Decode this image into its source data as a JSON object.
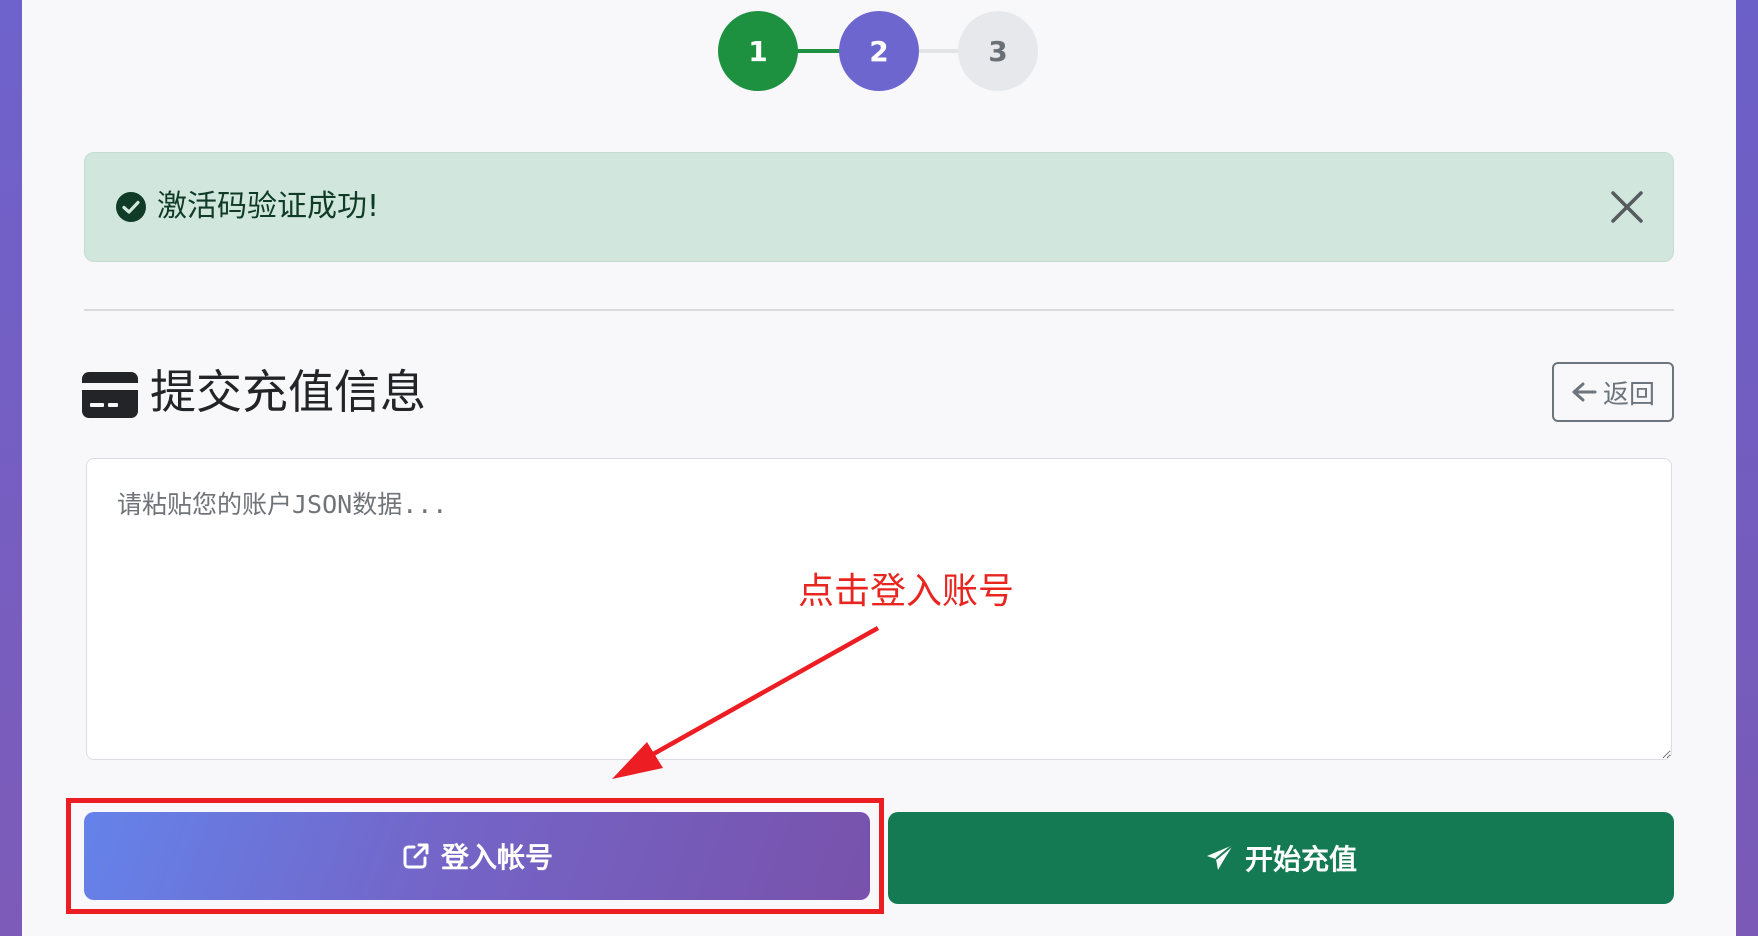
{
  "stepper": {
    "steps": [
      {
        "label": "1",
        "state": "completed"
      },
      {
        "label": "2",
        "state": "active"
      },
      {
        "label": "3",
        "state": "pending"
      }
    ]
  },
  "alert": {
    "message": "激活码验证成功!",
    "icon": "check-circle-icon",
    "close_icon": "close-icon"
  },
  "section": {
    "title": "提交充值信息",
    "icon": "credit-card-icon",
    "back_label": "返回"
  },
  "json_input": {
    "placeholder": "请粘贴您的账户JSON数据...",
    "value": ""
  },
  "annotation": {
    "text": "点击登入账号"
  },
  "actions": {
    "login_label": "登入帐号",
    "login_icon": "external-link-icon",
    "start_label": "开始充值",
    "start_icon": "send-icon"
  },
  "colors": {
    "success": "#1e9141",
    "active_step": "#6d66cf",
    "alert_bg": "#d1e7dd",
    "start_button": "#147a54",
    "annotation_red": "#e8261f"
  }
}
